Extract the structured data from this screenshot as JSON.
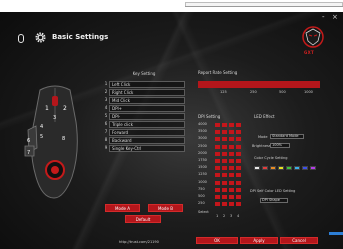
{
  "window": {
    "title": "Basic Settings",
    "minimize_label": "-",
    "close_label": "×",
    "brand_text": "GXT"
  },
  "key_settings": {
    "header": "Key Setting",
    "rows": [
      {
        "num": "1",
        "label": "Left Click"
      },
      {
        "num": "2",
        "label": "Right Click"
      },
      {
        "num": "3",
        "label": "Mid Click"
      },
      {
        "num": "4",
        "label": "DPI+"
      },
      {
        "num": "5",
        "label": "DPI-"
      },
      {
        "num": "6",
        "label": "Triple click"
      },
      {
        "num": "7",
        "label": "Forward"
      },
      {
        "num": "8",
        "label": "Backward"
      },
      {
        "num": "9",
        "label": "Single Key-Ctrl"
      }
    ],
    "mode_a_label": "Mode A",
    "mode_b_label": "Mode B",
    "default_label": "Default"
  },
  "report_rate": {
    "label": "Report Rate Setting",
    "ticks": [
      "125",
      "250",
      "500",
      "1000"
    ]
  },
  "dpi": {
    "header": "DPI Setting",
    "levels": [
      "4000",
      "3500",
      "3000",
      "2500",
      "2000",
      "1750",
      "1500",
      "1250",
      "1000",
      "750",
      "500",
      "250"
    ],
    "select_label": "Select",
    "columns": [
      "1",
      "2",
      "3",
      "4"
    ]
  },
  "led": {
    "header": "LED Effect",
    "mode_label": "Mode",
    "mode_value": "Standard Mode",
    "brightness_label": "Brightness",
    "brightness_value": "100%",
    "color_label": "Color Cycle Setting",
    "colors": [
      "#e8e8e8",
      "#e23c3c",
      "#e88b23",
      "#e8e023",
      "#3cc43c",
      "#3caee8",
      "#3c4fe8",
      "#b43ce8"
    ],
    "dpi_color_label": "DPI Self Color LED Setting",
    "dpi_color_value": "DPI Shape"
  },
  "footer": {
    "help_text": "http://trust.com/21190",
    "ok_label": "OK",
    "apply_label": "Apply",
    "cancel_label": "Cancel"
  }
}
